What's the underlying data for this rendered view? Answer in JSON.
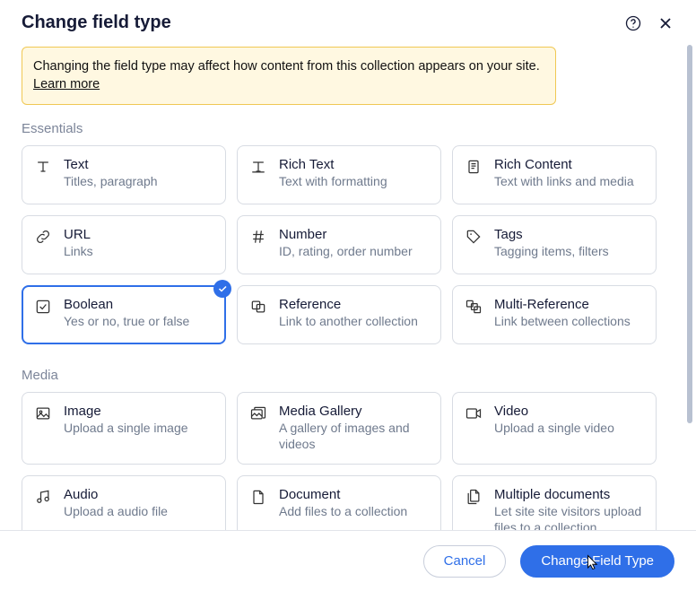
{
  "dialog": {
    "title": "Change field type",
    "help_icon": "help-icon",
    "close_icon": "close-icon"
  },
  "banner": {
    "text": "Changing the field type may affect how content from this collection appears on your site. ",
    "learn_more": "Learn more"
  },
  "sections": [
    {
      "label": "Essentials"
    },
    {
      "label": "Media"
    }
  ],
  "essentials": [
    {
      "key": "text",
      "name": "Text",
      "desc": "Titles, paragraph",
      "icon": "text-icon",
      "selected": false
    },
    {
      "key": "rich",
      "name": "Rich Text",
      "desc": "Text with formatting",
      "icon": "rich-text-icon",
      "selected": false
    },
    {
      "key": "richc",
      "name": "Rich Content",
      "desc": "Text with links and media",
      "icon": "document-icon",
      "selected": false
    },
    {
      "key": "url",
      "name": "URL",
      "desc": "Links",
      "icon": "link-icon",
      "selected": false
    },
    {
      "key": "num",
      "name": "Number",
      "desc": "ID, rating, order number",
      "icon": "hash-icon",
      "selected": false
    },
    {
      "key": "tags",
      "name": "Tags",
      "desc": "Tagging items, filters",
      "icon": "tag-icon",
      "selected": false
    },
    {
      "key": "bool",
      "name": "Boolean",
      "desc": "Yes or no, true or false",
      "icon": "checkbox-icon",
      "selected": true
    },
    {
      "key": "ref",
      "name": "Reference",
      "desc": "Link to another collection",
      "icon": "reference-icon",
      "selected": false
    },
    {
      "key": "mref",
      "name": "Multi-Reference",
      "desc": "Link between collections",
      "icon": "multi-reference-icon",
      "selected": false
    }
  ],
  "media": [
    {
      "key": "image",
      "name": "Image",
      "desc": "Upload a single image",
      "icon": "image-icon"
    },
    {
      "key": "gal",
      "name": "Media Gallery",
      "desc": "A gallery of images and videos",
      "icon": "gallery-icon"
    },
    {
      "key": "video",
      "name": "Video",
      "desc": "Upload a single video",
      "icon": "video-icon"
    },
    {
      "key": "audio",
      "name": "Audio",
      "desc": "Upload a audio file",
      "icon": "audio-icon"
    },
    {
      "key": "doc",
      "name": "Document",
      "desc": "Add files to a collection",
      "icon": "file-icon"
    },
    {
      "key": "mdoc",
      "name": "Multiple documents",
      "desc": "Let site site visitors upload files to a collection",
      "icon": "files-icon"
    }
  ],
  "footer": {
    "cancel": "Cancel",
    "confirm": "Change Field Type"
  }
}
